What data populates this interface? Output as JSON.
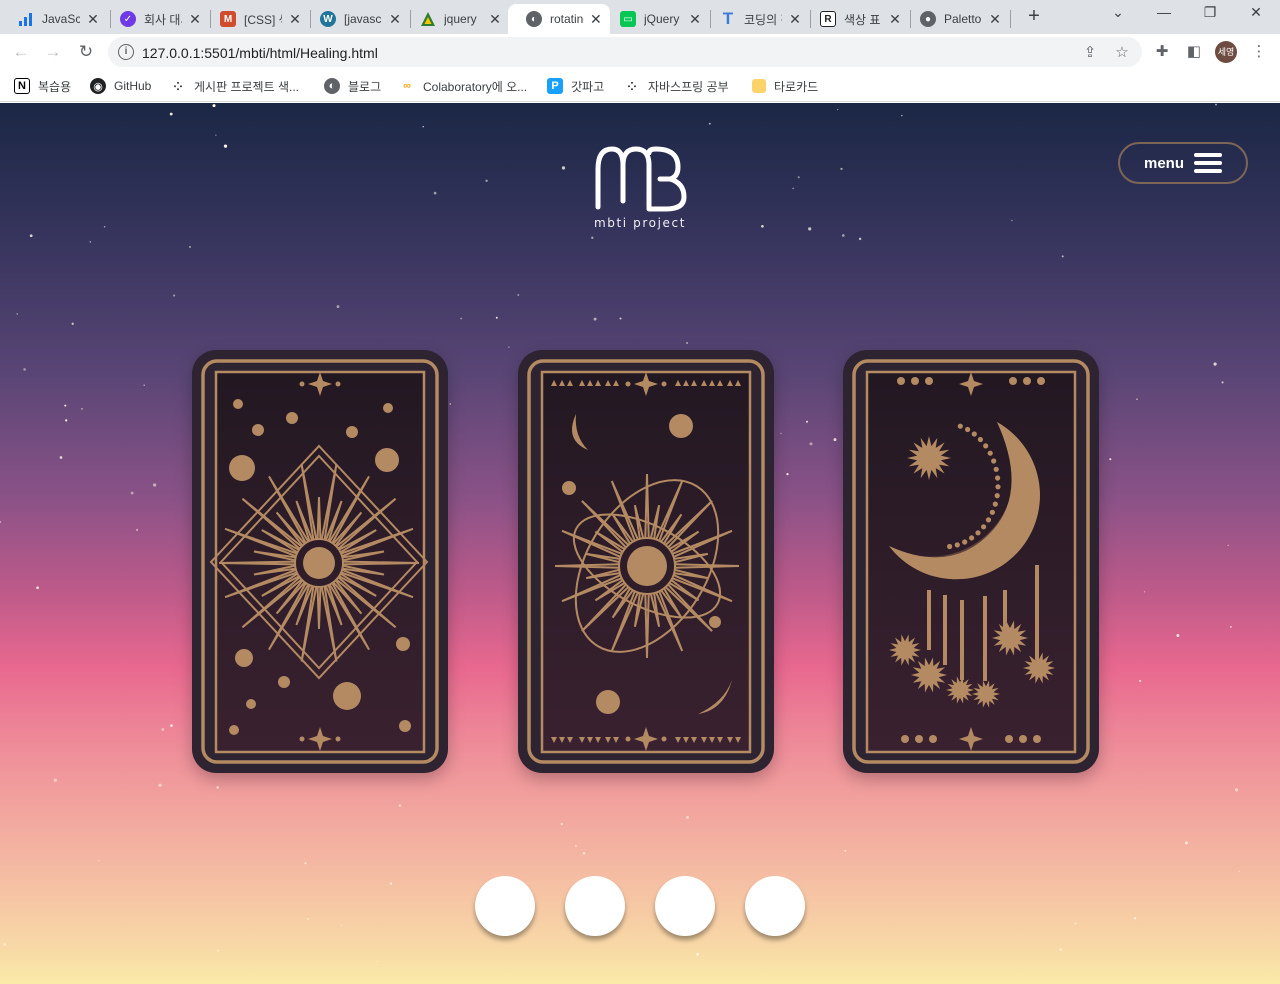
{
  "browser": {
    "tabs": [
      {
        "title": "JavaScript",
        "icon": "chart-bars-icon",
        "color": "#1a73e8",
        "active": false
      },
      {
        "title": "회사 대시보드",
        "icon": "brand-logo-icon",
        "color": "#6f3ae6",
        "active": false
      },
      {
        "title": "[CSS] 색상",
        "icon": "bookmark-ribbon-icon",
        "color": "#d14b2d",
        "active": false
      },
      {
        "title": "[javascript]",
        "icon": "wordpress-icon",
        "color": "#21759b",
        "active": false
      },
      {
        "title": "jquery",
        "icon": "triangle-logo-icon",
        "color": "#2e7d32",
        "active": false
      },
      {
        "title": "rotating",
        "icon": "globe-icon",
        "color": "#5f6368",
        "active": true
      },
      {
        "title": "jQuery",
        "icon": "chat-bubble-icon",
        "color": "#06c755",
        "active": false
      },
      {
        "title": "코딩의 정석",
        "icon": "letter-t-icon",
        "color": "#3d7bd9",
        "active": false
      },
      {
        "title": "색상 표",
        "icon": "letter-r-icon",
        "color": "#202124",
        "active": false
      },
      {
        "title": "Palettone",
        "icon": "palette-icon",
        "color": "#5f6368",
        "active": false
      }
    ],
    "new_tab_label": "+",
    "url": "127.0.0.1:5501/mbti/html/Healing.html",
    "profile_initials": "세영",
    "bookmarks": [
      {
        "label": "복습용",
        "icon": "notion-icon"
      },
      {
        "label": "GitHub",
        "icon": "github-icon"
      },
      {
        "label": "게시판 프로젝트 색...",
        "icon": "dots-grid-icon"
      },
      {
        "label": "블로그",
        "icon": "globe-icon"
      },
      {
        "label": "Colaboratory에 오...",
        "icon": "colab-icon"
      },
      {
        "label": "갓파고",
        "icon": "papago-icon"
      },
      {
        "label": "자바스프링 공부",
        "icon": "dots-grid-icon"
      },
      {
        "label": "타로카드",
        "icon": "folder-icon"
      }
    ]
  },
  "page": {
    "logo_text": "mbti project",
    "menu_label": "menu",
    "cards": [
      {
        "name": "sun-card",
        "design": "sun"
      },
      {
        "name": "orbit-card",
        "design": "orbit"
      },
      {
        "name": "moon-card",
        "design": "moon"
      }
    ],
    "dot_count": 4,
    "colors": {
      "card_bg": "#2e2330",
      "gold": "#b48a62",
      "card_inner": "#2a1e2b"
    }
  }
}
